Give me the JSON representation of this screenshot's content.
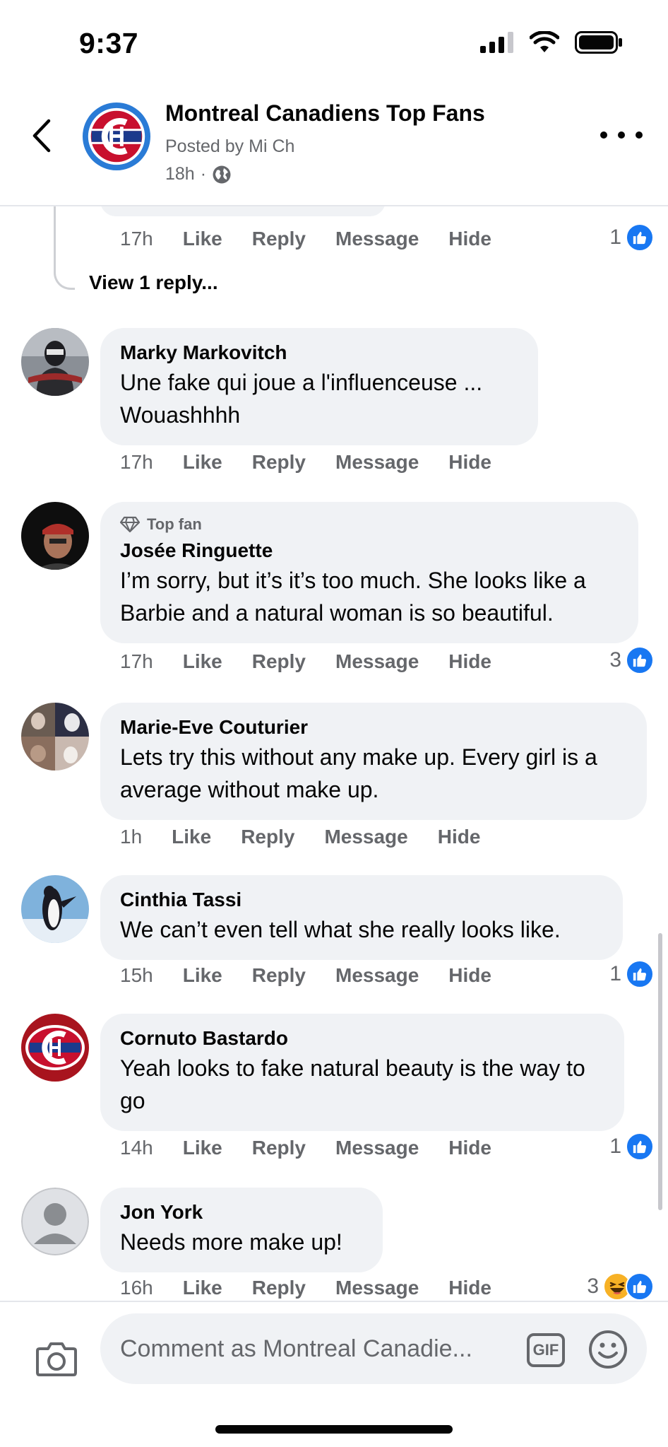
{
  "status_bar": {
    "time": "9:37"
  },
  "header": {
    "group_name": "Montreal Canadiens Top Fans",
    "posted_by": "Posted by Mi Ch",
    "post_time": "18h"
  },
  "top_thread": {
    "time": "17h",
    "actions": [
      "Like",
      "Reply",
      "Message",
      "Hide"
    ],
    "reaction_count": "1",
    "view_replies": "View 1 reply..."
  },
  "comments": [
    {
      "author": "Marky Markovitch",
      "text": "Une fake qui joue a l'influenceuse ... Wouashhhh",
      "time": "17h",
      "reaction_count": ""
    },
    {
      "badge": "Top fan",
      "author": "Josée Ringuette",
      "text": "I’m sorry, but it’s it’s too much. She looks like a Barbie and a natural woman is so beautiful.",
      "time": "17h",
      "reaction_count": "3"
    },
    {
      "author": "Marie-Eve Couturier",
      "text": "Lets try this without any make up. Every girl is a average without make up.",
      "time": "1h",
      "reaction_count": ""
    },
    {
      "author": "Cinthia Tassi",
      "text": "We can’t even tell what she really looks like.",
      "time": "15h",
      "reaction_count": "1"
    },
    {
      "author": "Cornuto Bastardo",
      "text": "Yeah looks to fake natural beauty is the way to go",
      "time": "14h",
      "reaction_count": "1"
    },
    {
      "author": "Jon York",
      "text": "Needs more make up!",
      "time": "16h",
      "reaction_count": "3"
    }
  ],
  "actions": {
    "like": "Like",
    "reply": "Reply",
    "message": "Message",
    "hide": "Hide"
  },
  "composer": {
    "placeholder": "Comment as Montreal Canadie...",
    "gif_label": "GIF"
  },
  "colors": {
    "accent": "#1877f2",
    "bubble": "#f0f2f5",
    "secondary_text": "#65676b",
    "habs_red": "#c8102e",
    "habs_blue": "#1b3a8c"
  }
}
